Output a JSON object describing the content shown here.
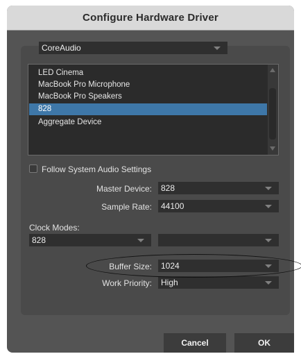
{
  "dialog": {
    "title": "Configure Hardware Driver"
  },
  "driver": {
    "selected": "CoreAudio"
  },
  "device_list": {
    "items": [
      "LED Cinema",
      "MacBook Pro Microphone",
      "MacBook Pro Speakers",
      "828",
      "Aggregate Device"
    ],
    "selected_index": 3
  },
  "follow_system": {
    "label": "Follow System Audio Settings",
    "checked": false
  },
  "master_device": {
    "label": "Master Device:",
    "value": "828"
  },
  "sample_rate": {
    "label": "Sample Rate:",
    "value": "44100"
  },
  "clock_modes": {
    "label": "Clock Modes:",
    "value": "828",
    "second_value": ""
  },
  "buffer_size": {
    "label": "Buffer Size:",
    "value": "1024"
  },
  "work_priority": {
    "label": "Work Priority:",
    "value": "High"
  },
  "buttons": {
    "cancel": "Cancel",
    "ok": "OK"
  }
}
